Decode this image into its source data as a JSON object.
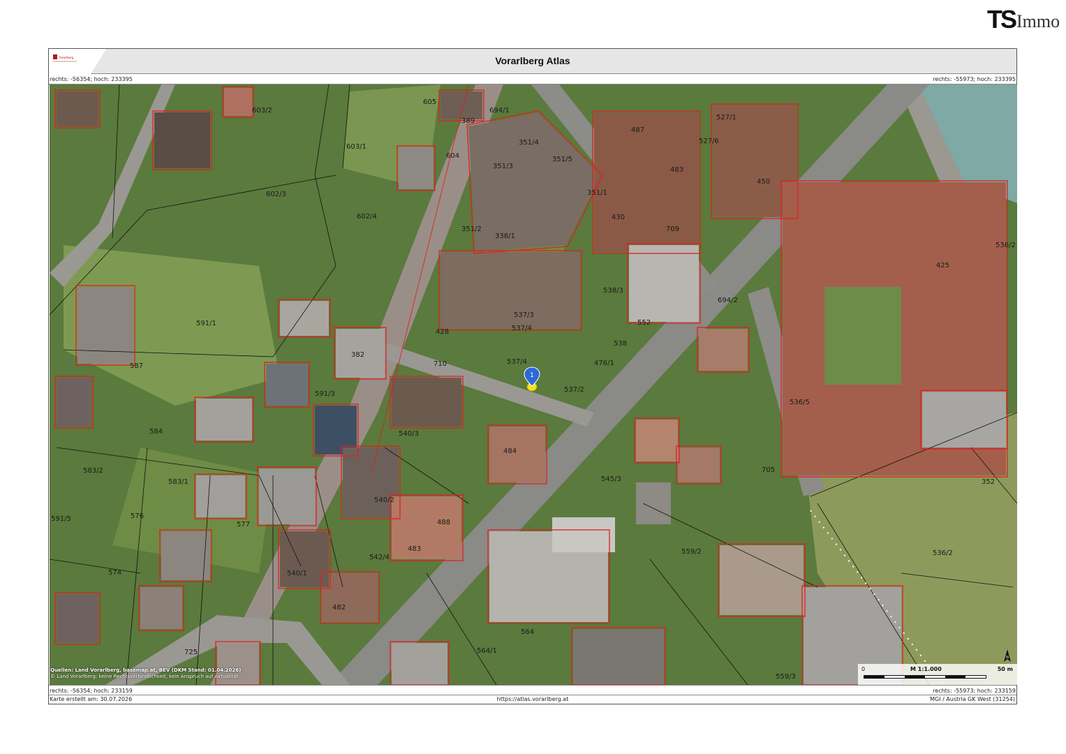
{
  "brand": {
    "logo_ts": "TS",
    "logo_immo": "Immo"
  },
  "header": {
    "title": "Vorarlberg Atlas",
    "logo_label": "Vorarlberg"
  },
  "coords": {
    "top_left": "rechts: -56354; hoch: 233395",
    "top_right": "rechts: -55973; hoch: 233395",
    "bottom_left": "rechts: -56354; hoch: 233159",
    "bottom_right": "rechts: -55973; hoch: 233159"
  },
  "footer": {
    "created": "Karte erstellt am: 30.07.2026",
    "url": "https://atlas.vorarlberg.at",
    "projection": "MGI / Austria GK West (31254)"
  },
  "sources": {
    "line1": "Quellen: Land Vorarlberg, basemap.at, BEV (DKM Stand: 01.04.2026)",
    "line2": "© Land Vorarlberg: keine Rechtsverbindlichkeit, kein Anspruch auf Aktualität"
  },
  "scale": {
    "zero": "0",
    "ratio": "M 1:1.000",
    "end": "50 m"
  },
  "marker": {
    "label": "1"
  },
  "colors": {
    "parcel": "#e02020",
    "boundary": "#111111",
    "road": "#8a8a86",
    "water": "#7fa9a4",
    "vegetation": "#4f6b32"
  },
  "parcels": [
    "603/2",
    "605",
    "389",
    "694/1",
    "604",
    "603/1",
    "602/3",
    "602/4",
    "351/4",
    "351/3",
    "351/5",
    "351/1",
    "351/2",
    "338/1",
    "430",
    "537/4",
    "487",
    "527/1",
    "527/6",
    "483",
    "450",
    "538/3",
    "537/3",
    "536/2",
    "591/1",
    "587",
    "591/3",
    "428",
    "538",
    "537/4",
    "537/2",
    "552",
    "476/1",
    "709",
    "694/2",
    "425",
    "536/5",
    "540/3",
    "484",
    "545/3",
    "540/2",
    "488",
    "542/4",
    "540/1",
    "483",
    "482",
    "584",
    "583/2",
    "583/1",
    "576",
    "577",
    "591/5",
    "574",
    "564",
    "564/1",
    "559/2",
    "536/2",
    "352",
    "705",
    "559/3",
    "725",
    "710",
    "382"
  ]
}
